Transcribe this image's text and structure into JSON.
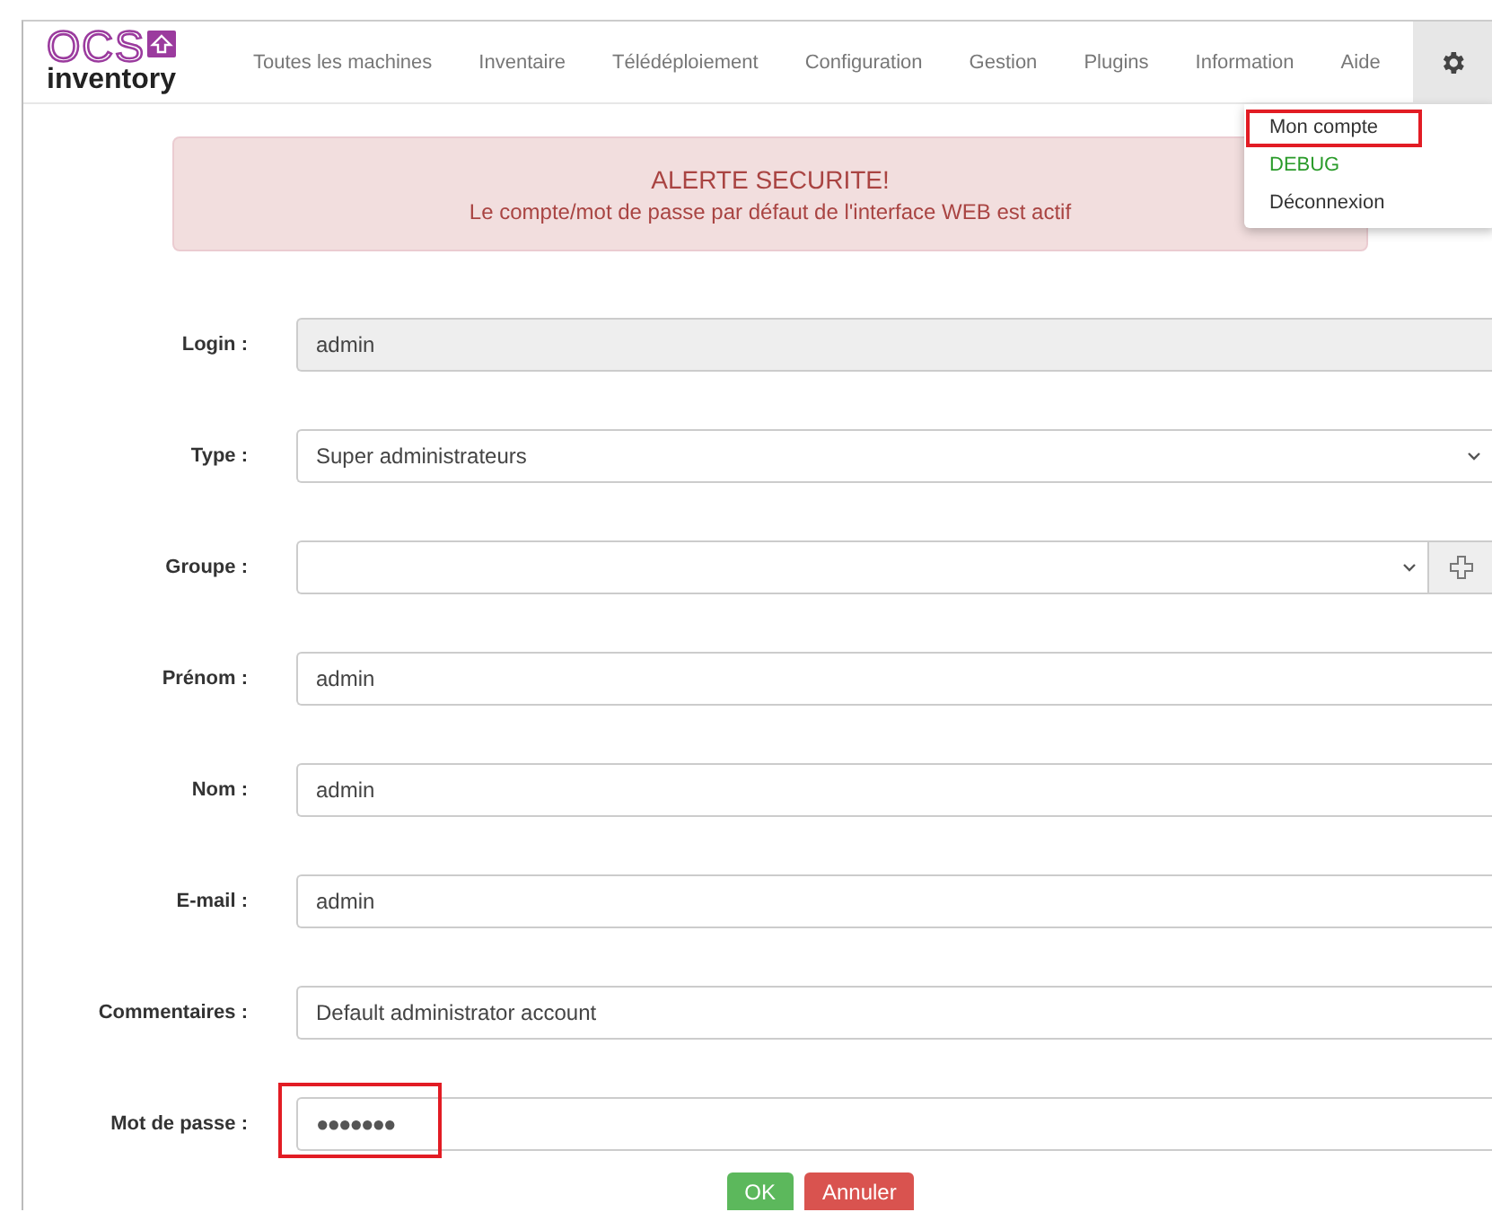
{
  "logo": {
    "top": "OCS",
    "bottom": "inventory"
  },
  "nav": {
    "items": [
      "Toutes les machines",
      "Inventaire",
      "Télédéploiement",
      "Configuration",
      "Gestion",
      "Plugins",
      "Information",
      "Aide"
    ],
    "settings_open": true
  },
  "user_menu": [
    {
      "label": "Mon compte",
      "kind": "normal",
      "highlighted": true
    },
    {
      "label": "DEBUG",
      "kind": "debug",
      "highlighted": false
    },
    {
      "label": "Déconnexion",
      "kind": "normal",
      "highlighted": false
    }
  ],
  "alert": {
    "title": "ALERTE SECURITE!",
    "message": "Le compte/mot de passe par défaut de l'interface WEB est actif"
  },
  "form": [
    {
      "label": "Login :",
      "kind": "text",
      "value": "admin",
      "disabled": true,
      "highlighted": false
    },
    {
      "label": "Type :",
      "kind": "select",
      "value": "Super administrateurs",
      "disabled": false,
      "highlighted": false
    },
    {
      "label": "Groupe :",
      "kind": "select_add",
      "disabled": false,
      "highlighted": false
    },
    {
      "label": "Prénom :",
      "kind": "text",
      "value": "admin",
      "disabled": false,
      "highlighted": false
    },
    {
      "label": "Nom :",
      "kind": "text",
      "value": "admin",
      "disabled": false,
      "highlighted": false
    },
    {
      "label": "E-mail :",
      "kind": "text",
      "value": "admin",
      "disabled": false,
      "highlighted": false
    },
    {
      "label": "Commentaires :",
      "kind": "text",
      "value": "Default administrator account",
      "disabled": false,
      "highlighted": false
    },
    {
      "label": "Mot de passe :",
      "kind": "password",
      "value": "●●●●●●●",
      "disabled": false,
      "highlighted": true
    }
  ],
  "buttons": [
    {
      "label": "OK",
      "kind": "ok"
    },
    {
      "label": "Annuler",
      "kind": "cancel"
    }
  ]
}
